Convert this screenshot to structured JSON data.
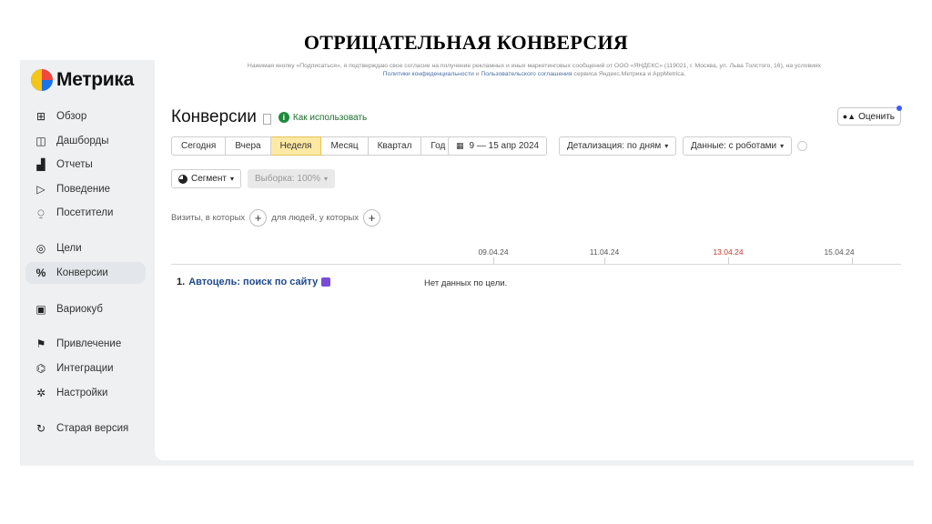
{
  "slide": {
    "title": "ОТРИЦАТЕЛЬНАЯ КОНВЕРСИЯ"
  },
  "app": {
    "logo_text": "Метрика"
  },
  "sidebar": {
    "items": [
      {
        "label": "Обзор",
        "icon": "grid-icon"
      },
      {
        "label": "Дашборды",
        "icon": "dashboard-icon"
      },
      {
        "label": "Отчеты",
        "icon": "bar-chart-icon"
      },
      {
        "label": "Поведение",
        "icon": "play-icon"
      },
      {
        "label": "Посетители",
        "icon": "user-icon"
      },
      {
        "label": "Цели",
        "icon": "target-icon"
      },
      {
        "label": "Конверсии",
        "icon": "percent-icon",
        "active": true
      },
      {
        "label": "Вариокуб",
        "icon": "cube-icon"
      },
      {
        "label": "Привлечение",
        "icon": "person-walk-icon"
      },
      {
        "label": "Интеграции",
        "icon": "plug-icon"
      },
      {
        "label": "Настройки",
        "icon": "gear-icon"
      },
      {
        "label": "Старая версия",
        "icon": "refresh-icon"
      }
    ]
  },
  "consent": {
    "text": "Нажимая кнопку «Подписаться», я подтверждаю свое согласие на получение рекламных и иных маркетинговых сообщений от ООО «ЯНДЕКС» (119021, г. Москва, ул. Льва Толстого, 16), на условиях",
    "privacy_link": "Политики конфиденциальности",
    "and": "и",
    "terms_link": "Пользовательского соглашения",
    "tail": "сервиса Яндекс.Метрика и AppMetrica."
  },
  "page": {
    "title": "Конверсии",
    "howto": "Как использовать",
    "rate_button": "Оценить"
  },
  "periods": [
    "Сегодня",
    "Вчера",
    "Неделя",
    "Месяц",
    "Квартал",
    "Год"
  ],
  "active_period": "Неделя",
  "date_range": "9 — 15 апр 2024",
  "detail": "Детализация: по дням",
  "robots": "Данные: с роботами",
  "segment": "Сегмент",
  "sample": "Выборка: 100%",
  "visits": {
    "prefix": "Визиты, в которых",
    "middle": "для людей, у которых"
  },
  "axis_dates": [
    {
      "label": "09.04.24",
      "holiday": false
    },
    {
      "label": "11.04.24",
      "holiday": false
    },
    {
      "label": "13.04.24",
      "holiday": true
    },
    {
      "label": "15.04.24",
      "holiday": false
    }
  ],
  "goal": {
    "number": "1.",
    "name": "Автоцель: поиск по сайту",
    "status": "Нет данных по цели."
  },
  "colors": {
    "accent_active_period": "#fde9a4",
    "goal_link": "#1e4a8c",
    "holiday_date": "#c0392b",
    "howto": "#1f6e2f"
  }
}
